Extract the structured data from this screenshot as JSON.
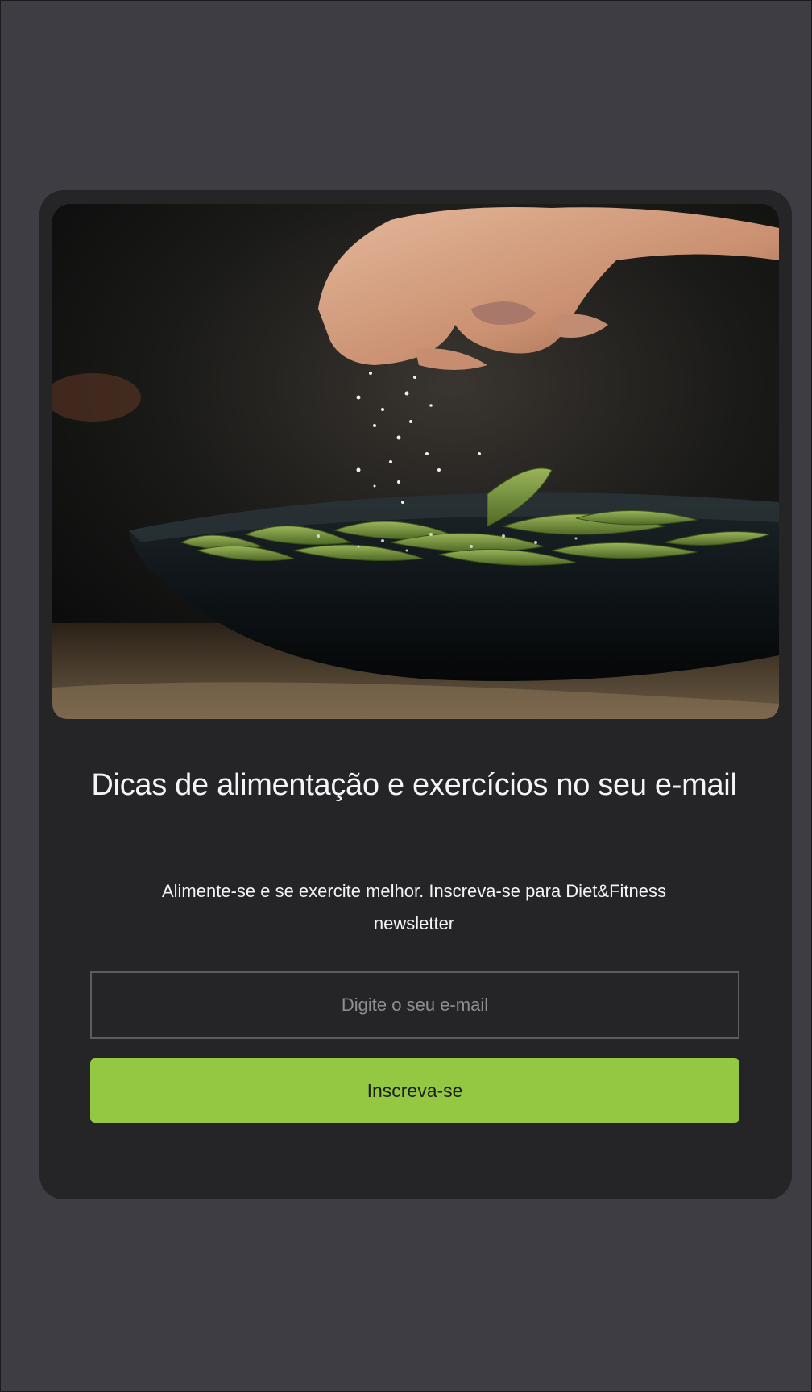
{
  "newsletter": {
    "image_alt": "Hand sprinkling salt over edamame pods in a dark bowl",
    "title": "Dicas de alimentação e exercícios no seu e-mail",
    "subtitle": "Alimente-se e se exercite melhor. Inscreva-se para Diet&Fitness newsletter",
    "email_placeholder": "Digite o seu e-mail",
    "email_value": "",
    "subscribe_label": "Inscreva-se"
  },
  "colors": {
    "page_background": "#3e3d44",
    "card_background": "#252528",
    "accent": "#94c843",
    "text": "#f4f4f4",
    "input_border": "#5c5c62"
  }
}
